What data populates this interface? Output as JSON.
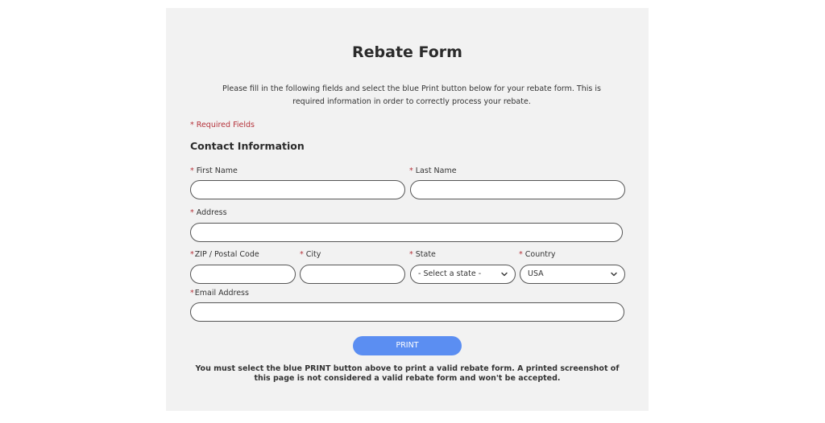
{
  "form": {
    "title": "Rebate Form",
    "intro": "Please fill in the following fields and select the blue Print button below for your rebate form. This is required information in order to correctly process your rebate.",
    "required_note": "* Required Fields",
    "section_title": "Contact Information",
    "required_marker": "*",
    "fields": {
      "first_name": {
        "label": "First Name",
        "value": "",
        "placeholder": ""
      },
      "last_name": {
        "label": "Last Name",
        "value": "",
        "placeholder": ""
      },
      "address": {
        "label": "Address",
        "value": "",
        "placeholder": ""
      },
      "zip": {
        "label": "ZIP / Postal Code",
        "value": "",
        "placeholder": ""
      },
      "city": {
        "label": "City",
        "value": "",
        "placeholder": ""
      },
      "state": {
        "label": "State",
        "selected": "- Select a state -"
      },
      "country": {
        "label": "Country",
        "selected": "USA"
      },
      "email": {
        "label": "Email Address",
        "value": "",
        "placeholder": ""
      }
    },
    "print_button": "PRINT",
    "footer_note": "You must select the blue PRINT button above to print a valid rebate form. A printed screenshot of this page is not considered a valid rebate form and won't be accepted."
  },
  "colors": {
    "panel_bg": "#f2f2f2",
    "required_red": "#b5323a",
    "print_blue": "#5b8ef2",
    "field_border": "#555555"
  },
  "icons": {
    "select_arrow": "chevron-down-icon"
  }
}
